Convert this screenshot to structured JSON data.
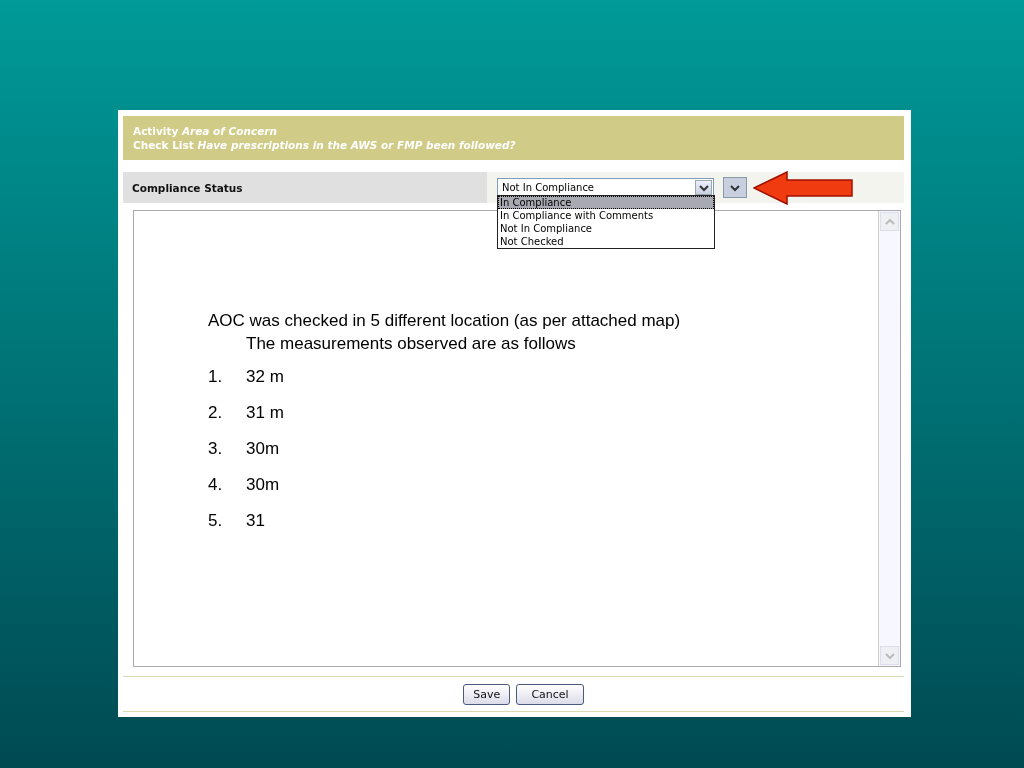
{
  "header": {
    "lines": [
      "Activity *Area of Concern*",
      "Check List *Have prescriptions in the AWS or FMP been followed?*"
    ]
  },
  "compliance": {
    "label": "Compliance Status",
    "value": "Not In Compliance",
    "options": [
      {
        "label": "In Compliance",
        "highlighted": true
      },
      {
        "label": "In Compliance with Comments",
        "highlighted": false
      },
      {
        "label": "Not In Compliance",
        "highlighted": false
      },
      {
        "label": "Not Checked",
        "highlighted": false
      }
    ]
  },
  "memo": {
    "paragraph": "AOC was checked in 5 different location (as per attached map)  The measurements observed are as follows",
    "items": [
      {
        "number": "1.",
        "text": "32 m"
      },
      {
        "number": "2.",
        "text": "31 m"
      },
      {
        "number": "3.",
        "text": "30m"
      },
      {
        "number": "4.",
        "text": "30m"
      },
      {
        "number": "5.",
        "text": "31"
      }
    ]
  },
  "buttons": [
    "Save",
    "Cancel"
  ]
}
